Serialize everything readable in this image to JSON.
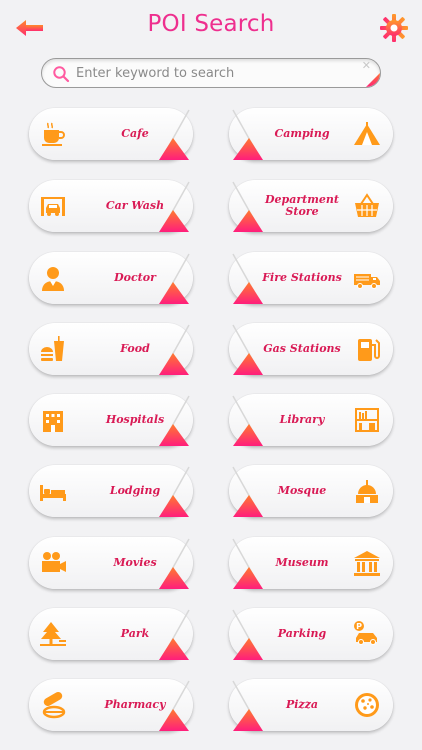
{
  "header": {
    "title": "POI Search",
    "back_icon": "back-arrow-icon",
    "settings_icon": "settings-gear-icon"
  },
  "search": {
    "placeholder": "Enter keyword to search",
    "value": ""
  },
  "colors": {
    "accent": "#ee2f8e",
    "icon": "#ff9a1a",
    "label": "#d91a55",
    "triangle_top": "#ff7a2f",
    "triangle_bottom": "#ff1e7c"
  },
  "categories": [
    {
      "label": "Cafe",
      "icon": "coffee-cup-icon"
    },
    {
      "label": "Camping",
      "icon": "tent-icon"
    },
    {
      "label": "Car Wash",
      "icon": "car-wash-icon"
    },
    {
      "label": "Department Store",
      "icon": "shopping-basket-icon"
    },
    {
      "label": "Doctor",
      "icon": "doctor-icon"
    },
    {
      "label": "Fire Stations",
      "icon": "fire-truck-icon"
    },
    {
      "label": "Food",
      "icon": "fast-food-icon"
    },
    {
      "label": "Gas Stations",
      "icon": "fuel-pump-icon"
    },
    {
      "label": "Hospitals",
      "icon": "hospital-building-icon"
    },
    {
      "label": "Library",
      "icon": "bookshelf-icon"
    },
    {
      "label": "Lodging",
      "icon": "bed-icon"
    },
    {
      "label": "Mosque",
      "icon": "mosque-dome-icon"
    },
    {
      "label": "Movies",
      "icon": "movie-camera-icon"
    },
    {
      "label": "Museum",
      "icon": "museum-icon"
    },
    {
      "label": "Park",
      "icon": "park-tree-icon"
    },
    {
      "label": "Parking",
      "icon": "parking-car-icon"
    },
    {
      "label": "Pharmacy",
      "icon": "pills-icon"
    },
    {
      "label": "Pizza",
      "icon": "pizza-icon"
    }
  ]
}
